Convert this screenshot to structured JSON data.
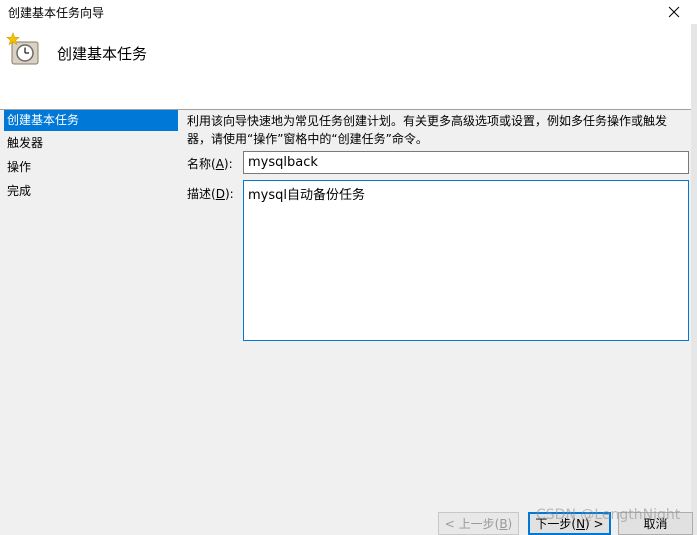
{
  "window": {
    "title": "创建基本任务向导",
    "close_icon": "✕"
  },
  "header": {
    "icon": "task-clock-icon",
    "title": "创建基本任务"
  },
  "sidebar": {
    "items": [
      {
        "label": "创建基本任务",
        "selected": true
      },
      {
        "label": "触发器",
        "selected": false
      },
      {
        "label": "操作",
        "selected": false
      },
      {
        "label": "完成",
        "selected": false
      }
    ]
  },
  "main": {
    "intro": "利用该向导快速地为常见任务创建计划。有关更多高级选项或设置，例如多任务操作或触发器，请使用“操作”窗格中的“创建任务”命令。",
    "name_label_prefix": "名称(",
    "name_label_key": "A",
    "name_label_suffix": "):",
    "name_value": "mysqlback",
    "desc_label_prefix": "描述(",
    "desc_label_key": "D",
    "desc_label_suffix": "):",
    "desc_value": "mysql自动备份任务"
  },
  "buttons": {
    "back_prefix": "< 上一步(",
    "back_key": "B",
    "back_suffix": ")",
    "next_prefix": "下一步(",
    "next_key": "N",
    "next_suffix": ") >",
    "cancel": "取消"
  },
  "watermark": "CSDN @LengthNight",
  "colors": {
    "accent": "#0078d7",
    "background": "#f0f0f0",
    "header_background": "#ffffff"
  }
}
